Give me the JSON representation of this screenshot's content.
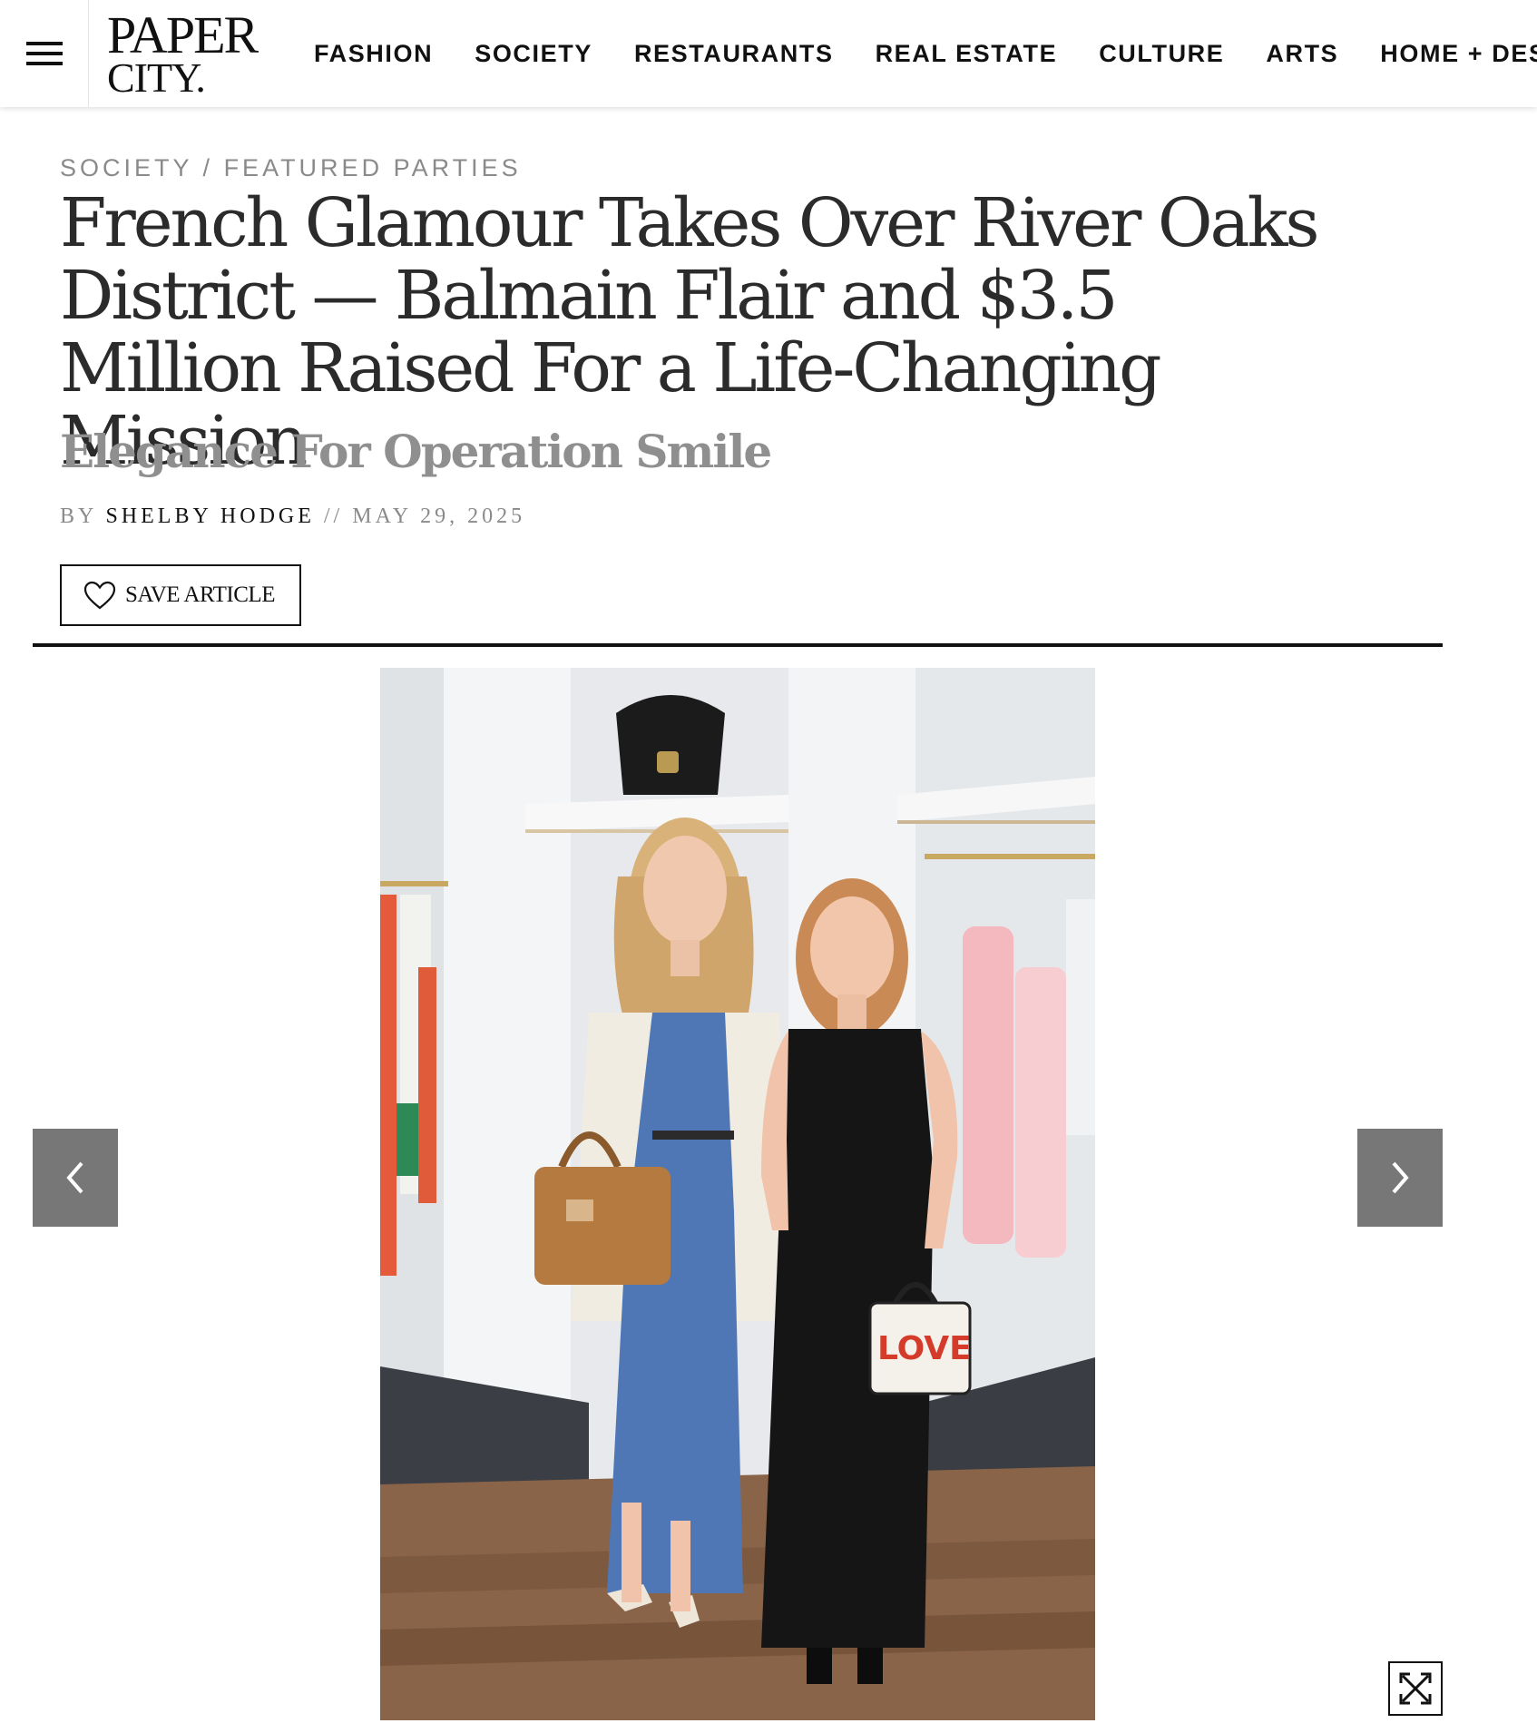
{
  "header": {
    "menu_icon": "hamburger-menu-icon",
    "logo": {
      "line1": "PAPER",
      "line2": "CITY."
    },
    "nav": [
      "FASHION",
      "SOCIETY",
      "RESTAURANTS",
      "REAL ESTATE",
      "CULTURE",
      "ARTS",
      "HOME + DESIGN"
    ]
  },
  "article": {
    "breadcrumb": {
      "section": "SOCIETY",
      "separator": " / ",
      "category": "FEATURED PARTIES"
    },
    "title": "French Glamour Takes Over River Oaks District — Balmain Flair and $3.5 Million Raised For a Life-Changing Mission",
    "subtitle": "Elegance For Operation Smile",
    "byline": {
      "by": "BY ",
      "author": "SHELBY HODGE",
      "separator": " // ",
      "date": "MAY 29, 2025"
    },
    "save_button": {
      "label": "SAVE ARTICLE",
      "icon": "heart-icon"
    }
  },
  "gallery": {
    "prev_icon": "chevron-left-icon",
    "next_icon": "chevron-right-icon",
    "expand_icon": "expand-arrows-icon",
    "photo_text": "LOVE"
  },
  "colors": {
    "accent_dark": "#111111",
    "muted_text": "#8a8a8a",
    "arrow_bg": "#777777"
  }
}
